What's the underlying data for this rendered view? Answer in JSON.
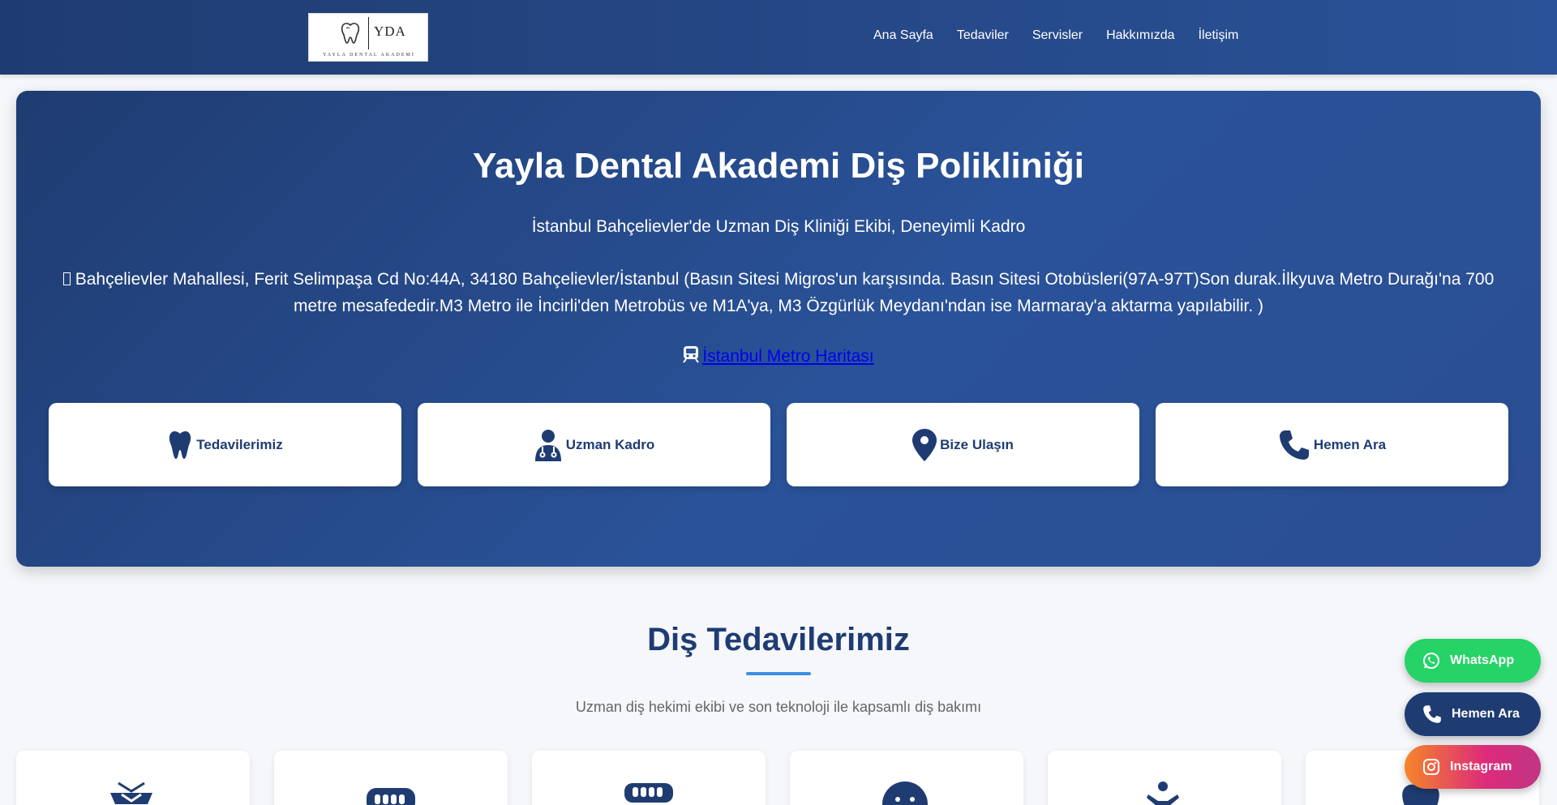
{
  "header": {
    "logo": {
      "abbr": "YDA",
      "full": "YAYLA DENTAL AKADEMİ"
    },
    "nav": [
      "Ana Sayfa",
      "Tedaviler",
      "Servisler",
      "Hakkımızda",
      "İletişim"
    ]
  },
  "hero": {
    "title": "Yayla Dental Akademi Diş Polikliniği",
    "subtitle": "İstanbul Bahçelievler'de Uzman Diş Kliniği Ekibi, Deneyimli Kadro",
    "address": "Bahçelievler Mahallesi, Ferit Selimpaşa Cd No:44A, 34180 Bahçelievler/İstanbul (Basın Sitesi Migros'un karşısında. Basın Sitesi Otobüsleri(97A-97T)Son durak.İlkyuva Metro Durağı'na 700 metre mesafededir.M3 Metro ile İncirli'den Metrobüs ve M1A'ya, M3 Özgürlük Meydanı'ndan ise Marmaray'a aktarma yapılabilir. )",
    "metro_link": "İstanbul Metro Haritası",
    "cards": [
      {
        "label": "Tedavilerimiz",
        "icon": "tooth-icon"
      },
      {
        "label": "Uzman Kadro",
        "icon": "doctor-icon"
      },
      {
        "label": "Bize Ulaşın",
        "icon": "map-pin-icon"
      },
      {
        "label": "Hemen Ara",
        "icon": "phone-icon"
      }
    ]
  },
  "services": {
    "title": "Diş Tedavilerimiz",
    "subtitle": "Uzman diş hekimi ekibi ve son teknoloji ile kapsamlı diş bakımı",
    "icons": [
      "implant-icon",
      "teeth-row-icon",
      "teeth-row-icon",
      "smile-icon",
      "child-icon",
      "tooth-icon"
    ]
  },
  "floating": {
    "whatsapp": "WhatsApp",
    "call": "Hemen Ara",
    "instagram": "Instagram"
  },
  "colors": {
    "primary": "#1f3c72",
    "accent": "#3d8fe0",
    "whatsapp": "#25d366"
  }
}
